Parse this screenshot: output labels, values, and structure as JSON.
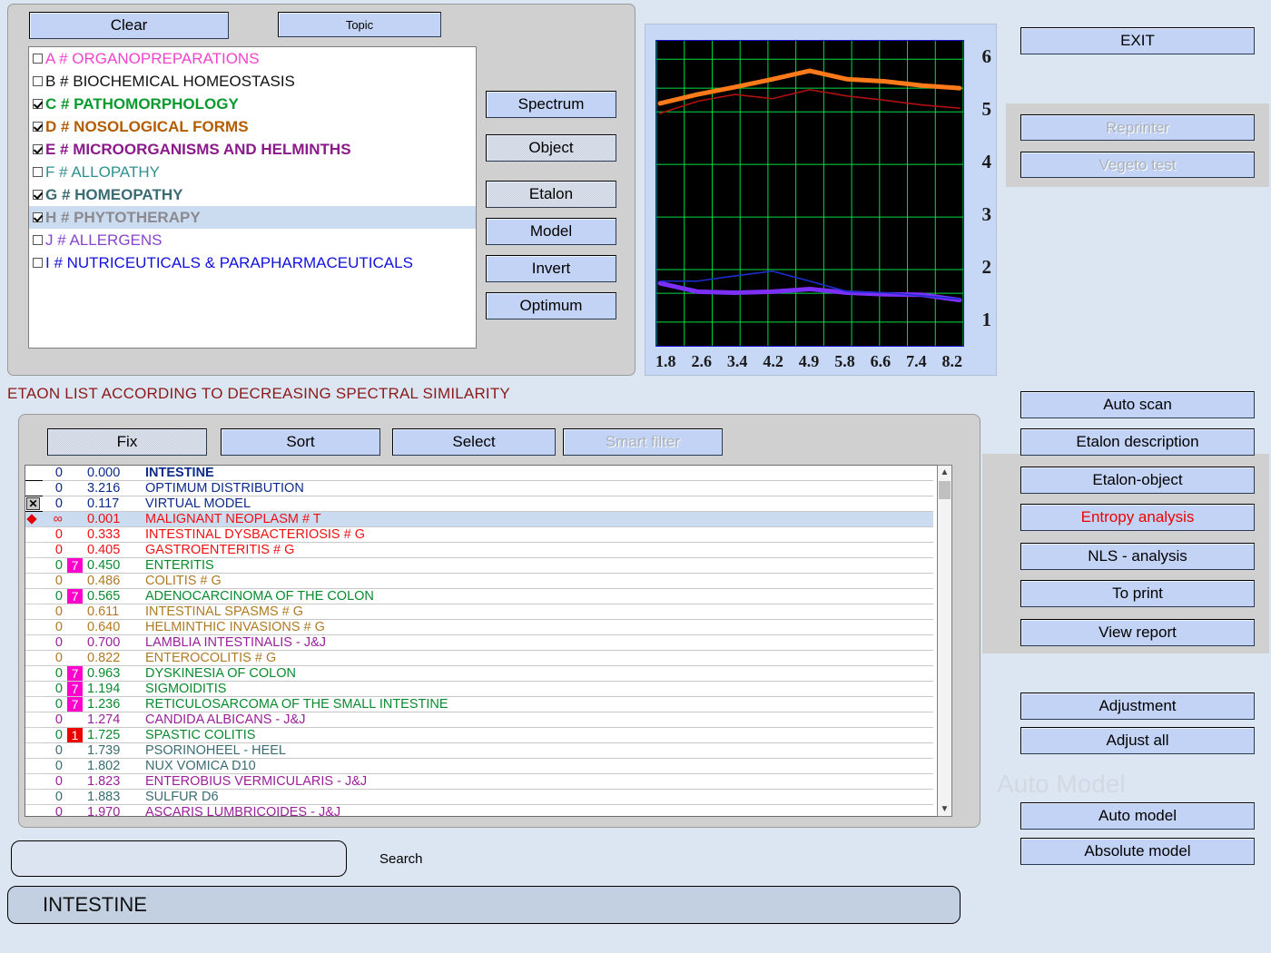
{
  "toolbar": {
    "clear_label": "Clear",
    "topic_label": "Topic"
  },
  "categories": [
    {
      "code": "A",
      "label": "A # ORGANOPREPARATIONS",
      "checked": false,
      "color": "#ee44cc",
      "bold": false,
      "selected": false
    },
    {
      "code": "B",
      "label": "B # BIOCHEMICAL HOMEOSTASIS",
      "checked": false,
      "color": "#111111",
      "bold": false,
      "selected": false
    },
    {
      "code": "C",
      "label": "C # PATHOMORPHOLOGY",
      "checked": true,
      "color": "#0a9a2e",
      "bold": true,
      "selected": false
    },
    {
      "code": "D",
      "label": "D # NOSOLOGICAL  FORMS",
      "checked": true,
      "color": "#b35c00",
      "bold": true,
      "selected": false
    },
    {
      "code": "E",
      "label": "E # MICROORGANISMS AND HELMINTHS",
      "checked": true,
      "color": "#8a1a8a",
      "bold": true,
      "selected": false
    },
    {
      "code": "F",
      "label": "F # ALLOPATHY",
      "checked": false,
      "color": "#2e9090",
      "bold": false,
      "selected": false
    },
    {
      "code": "G",
      "label": "G # HOMEOPATHY",
      "checked": true,
      "color": "#3b6b73",
      "bold": true,
      "selected": false
    },
    {
      "code": "H",
      "label": "H # PHYTOTHERAPY",
      "checked": true,
      "color": "#8a8a90",
      "bold": true,
      "selected": true
    },
    {
      "code": "J",
      "label": "J # ALLERGENS",
      "checked": false,
      "color": "#8844cc",
      "bold": false,
      "selected": false
    },
    {
      "code": "I",
      "label": "I # NUTRICEUTICALS & PARAPHARMACEUTICALS",
      "checked": false,
      "color": "#1111dd",
      "bold": false,
      "selected": false
    }
  ],
  "mode_buttons": [
    {
      "label": "Spectrum",
      "state": "normal"
    },
    {
      "label": "Object",
      "state": "pressed"
    },
    {
      "label": "Etalon",
      "state": "pressed"
    },
    {
      "label": "Model",
      "state": "normal"
    },
    {
      "label": "Invert",
      "state": "normal"
    },
    {
      "label": "Optimum",
      "state": "normal"
    }
  ],
  "chart_data": {
    "type": "line",
    "title": "",
    "xlabel": "",
    "ylabel": "",
    "x": [
      1.8,
      2.6,
      3.4,
      4.2,
      4.9,
      5.8,
      6.6,
      7.4,
      8.2
    ],
    "xtick_labels": [
      "1.8",
      "2.6",
      "3.4",
      "4.2",
      "4.9",
      "5.8",
      "6.6",
      "7.4",
      "8.2"
    ],
    "ytick_labels": [
      "6",
      "5",
      "4",
      "3",
      "2",
      "1"
    ],
    "ylim": [
      0.55,
      6.35
    ],
    "grid": true,
    "background": "#000000",
    "grid_color": "#00dd44",
    "legend": "none",
    "series": [
      {
        "name": "object-upper",
        "color": "#ff7a18",
        "width": 5,
        "values": [
          5.16,
          5.33,
          5.47,
          5.62,
          5.78,
          5.62,
          5.58,
          5.5,
          5.45
        ]
      },
      {
        "name": "etalon-upper",
        "color": "#b01010",
        "width": 1.6,
        "values": [
          4.97,
          5.2,
          5.33,
          5.25,
          5.42,
          5.3,
          5.22,
          5.13,
          5.07
        ]
      },
      {
        "name": "object-lower",
        "color": "#7b2ff7",
        "width": 5,
        "values": [
          1.74,
          1.58,
          1.56,
          1.58,
          1.63,
          1.56,
          1.53,
          1.52,
          1.42
        ]
      },
      {
        "name": "etalon-lower",
        "color": "#1a2fd0",
        "width": 1.6,
        "values": [
          1.78,
          1.78,
          1.88,
          1.97,
          1.78,
          1.58,
          1.56,
          1.5,
          1.44
        ]
      }
    ]
  },
  "right_panel": {
    "exit_label": "EXIT",
    "reprinter_label": "Reprinter",
    "vegeto_label": "Vegeto test",
    "analysis_buttons": [
      {
        "label": "Auto scan",
        "state": "normal"
      },
      {
        "label": "Etalon description",
        "state": "normal"
      },
      {
        "label": "Etalon-object",
        "state": "normal"
      },
      {
        "label": "Entropy analysis",
        "state": "red"
      },
      {
        "label": "NLS - analysis",
        "state": "normal"
      },
      {
        "label": "To print",
        "state": "normal"
      },
      {
        "label": "View report",
        "state": "normal"
      }
    ],
    "adjust_buttons": [
      {
        "label": "Adjustment",
        "state": "normal"
      },
      {
        "label": "Adjust all",
        "state": "normal"
      }
    ],
    "auto_model_watermark": "Auto Model",
    "model_buttons": [
      {
        "label": "Auto model",
        "state": "normal"
      },
      {
        "label": "Absolute model",
        "state": "normal"
      }
    ]
  },
  "etalon": {
    "header": "ETAON LIST ACCORDING TO DECREASING SPECTRAL SIMILARITY",
    "buttons": [
      {
        "label": "Fix",
        "state": "pressed"
      },
      {
        "label": "Sort",
        "state": "normal"
      },
      {
        "label": "Select",
        "state": "normal"
      },
      {
        "label": "Smart filter",
        "state": "disabled"
      }
    ],
    "rows": [
      {
        "mark": "none",
        "count": "0",
        "badge": "",
        "badge_color": "",
        "value": "0.000",
        "name": "INTESTINE",
        "color": "#0c2a8a",
        "bold": true,
        "selected": false,
        "hardline": true
      },
      {
        "mark": "none",
        "count": "0",
        "badge": "",
        "badge_color": "",
        "value": "3.216",
        "name": "OPTIMUM DISTRIBUTION",
        "color": "#0c2a8a",
        "bold": false,
        "selected": false,
        "hardline": true
      },
      {
        "mark": "x",
        "count": "0",
        "badge": "",
        "badge_color": "",
        "value": "0.117",
        "name": "VIRTUAL MODEL",
        "color": "#0c2a8a",
        "bold": false,
        "selected": false,
        "hardline": true
      },
      {
        "mark": "diamond",
        "count": "∞",
        "badge": "",
        "badge_color": "",
        "value": "0.001",
        "name": "MALIGNANT  NEOPLASM  # T",
        "color": "#ee1111",
        "bold": false,
        "selected": true,
        "hardline": false
      },
      {
        "mark": "none",
        "count": "0",
        "badge": "",
        "badge_color": "",
        "value": "0.333",
        "name": "INTESTINAL  DYSBACTERIOSIS  # G",
        "color": "#ee1111",
        "bold": false,
        "selected": false,
        "hardline": false
      },
      {
        "mark": "none",
        "count": "0",
        "badge": "",
        "badge_color": "",
        "value": "0.405",
        "name": "GASTROENTERITIS # G",
        "color": "#ee1111",
        "bold": false,
        "selected": false,
        "hardline": false
      },
      {
        "mark": "none",
        "count": "0",
        "badge": "7",
        "badge_color": "magenta",
        "value": "0.450",
        "name": "ENTERITIS",
        "color": "#0a8a2e",
        "bold": false,
        "selected": false,
        "hardline": false
      },
      {
        "mark": "none",
        "count": "0",
        "badge": "",
        "badge_color": "",
        "value": "0.486",
        "name": "COLITIS # G",
        "color": "#b07a22",
        "bold": false,
        "selected": false,
        "hardline": false
      },
      {
        "mark": "none",
        "count": "0",
        "badge": "7",
        "badge_color": "magenta",
        "value": "0.565",
        "name": "ADENOCARCINOMA OF THE COLON",
        "color": "#0a8a2e",
        "bold": false,
        "selected": false,
        "hardline": false
      },
      {
        "mark": "none",
        "count": "0",
        "badge": "",
        "badge_color": "",
        "value": "0.611",
        "name": "INTESTINAL SPASMS # G",
        "color": "#b07a22",
        "bold": false,
        "selected": false,
        "hardline": false
      },
      {
        "mark": "none",
        "count": "0",
        "badge": "",
        "badge_color": "",
        "value": "0.640",
        "name": "HELMINTHIC  INVASIONS # G",
        "color": "#b07a22",
        "bold": false,
        "selected": false,
        "hardline": false
      },
      {
        "mark": "none",
        "count": "0",
        "badge": "",
        "badge_color": "",
        "value": "0.700",
        "name": "LAMBLIA  INTESTINALIS  -  J&J",
        "color": "#9a1f9a",
        "bold": false,
        "selected": false,
        "hardline": false
      },
      {
        "mark": "none",
        "count": "0",
        "badge": "",
        "badge_color": "",
        "value": "0.822",
        "name": "ENTEROCOLITIS # G",
        "color": "#b07a22",
        "bold": false,
        "selected": false,
        "hardline": false
      },
      {
        "mark": "none",
        "count": "0",
        "badge": "7",
        "badge_color": "magenta",
        "value": "0.963",
        "name": "DYSKINESIA  OF COLON",
        "color": "#0a8a2e",
        "bold": false,
        "selected": false,
        "hardline": false
      },
      {
        "mark": "none",
        "count": "0",
        "badge": "7",
        "badge_color": "magenta",
        "value": "1.194",
        "name": "SIGMOIDITIS",
        "color": "#0a8a2e",
        "bold": false,
        "selected": false,
        "hardline": false
      },
      {
        "mark": "none",
        "count": "0",
        "badge": "7",
        "badge_color": "magenta",
        "value": "1.236",
        "name": "RETICULOSARCOMA  OF  THE  SMALL  INTESTINE",
        "color": "#0a8a2e",
        "bold": false,
        "selected": false,
        "hardline": false
      },
      {
        "mark": "none",
        "count": "0",
        "badge": "",
        "badge_color": "",
        "value": "1.274",
        "name": "CANDIDA  ALBICANS  -  J&J",
        "color": "#9a1f9a",
        "bold": false,
        "selected": false,
        "hardline": false
      },
      {
        "mark": "none",
        "count": "0",
        "badge": "1",
        "badge_color": "red",
        "value": "1.725",
        "name": "SPASTIC  COLITIS",
        "color": "#0a8a2e",
        "bold": false,
        "selected": false,
        "hardline": false
      },
      {
        "mark": "none",
        "count": "0",
        "badge": "",
        "badge_color": "",
        "value": "1.739",
        "name": "PSORINOHEEL  -  HEEL",
        "color": "#3b6b73",
        "bold": false,
        "selected": false,
        "hardline": false
      },
      {
        "mark": "none",
        "count": "0",
        "badge": "",
        "badge_color": "",
        "value": "1.802",
        "name": "NUX  VOMICA  D10",
        "color": "#3b6b73",
        "bold": false,
        "selected": false,
        "hardline": false
      },
      {
        "mark": "none",
        "count": "0",
        "badge": "",
        "badge_color": "",
        "value": "1.823",
        "name": "ENTEROBIUS  VERMICULARIS  -  J&J",
        "color": "#9a1f9a",
        "bold": false,
        "selected": false,
        "hardline": false
      },
      {
        "mark": "none",
        "count": "0",
        "badge": "",
        "badge_color": "",
        "value": "1.883",
        "name": "SULFUR   D6",
        "color": "#3b6b73",
        "bold": false,
        "selected": false,
        "hardline": false
      },
      {
        "mark": "none",
        "count": "0",
        "badge": "",
        "badge_color": "",
        "value": "1.970",
        "name": "ASCARIS  LUMBRICOIDES  -  J&J",
        "color": "#9a1f9a",
        "bold": false,
        "selected": false,
        "hardline": false
      }
    ]
  },
  "bottom": {
    "search_value": "",
    "search_placeholder": "",
    "search_label": "Search",
    "status_text": "INTESTINE"
  }
}
